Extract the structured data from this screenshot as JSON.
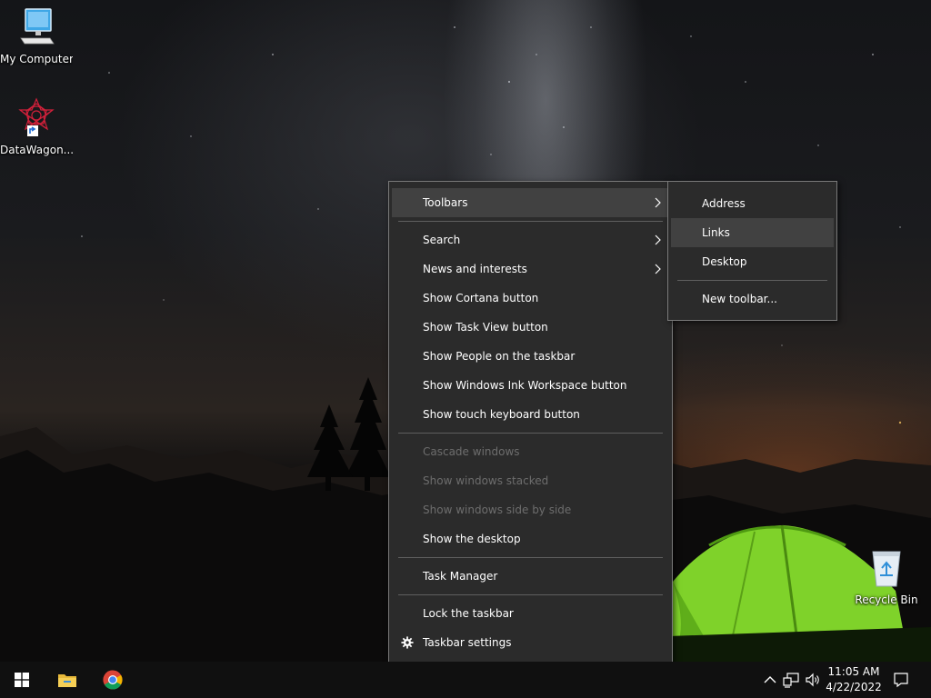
{
  "desktop": {
    "icons": [
      {
        "label": "My Computer",
        "icon": "computer-icon"
      },
      {
        "label": "DataWagon...",
        "icon": "datawagon-icon"
      },
      {
        "label": "Recycle Bin",
        "icon": "recycle-bin-icon"
      }
    ]
  },
  "context_menu": {
    "items": [
      {
        "label": "Toolbars",
        "submenu": true
      },
      {
        "label": "Search",
        "submenu": true
      },
      {
        "label": "News and interests",
        "submenu": true
      },
      {
        "label": "Show Cortana button"
      },
      {
        "label": "Show Task View button"
      },
      {
        "label": "Show People on the taskbar"
      },
      {
        "label": "Show Windows Ink Workspace button"
      },
      {
        "label": "Show touch keyboard button"
      },
      {
        "label": "Cascade windows",
        "disabled": true
      },
      {
        "label": "Show windows stacked",
        "disabled": true
      },
      {
        "label": "Show windows side by side",
        "disabled": true
      },
      {
        "label": "Show the desktop"
      },
      {
        "label": "Task Manager"
      },
      {
        "label": "Lock the taskbar"
      },
      {
        "label": "Taskbar settings",
        "icon": "gear-icon"
      }
    ]
  },
  "toolbars_submenu": {
    "items": [
      {
        "label": "Address"
      },
      {
        "label": "Links"
      },
      {
        "label": "Desktop"
      },
      {
        "label": "New toolbar..."
      }
    ]
  },
  "taskbar": {
    "pinned": [
      "windows-start-icon",
      "file-explorer-icon",
      "chrome-icon"
    ],
    "tray": [
      "chevron-up-icon",
      "network-icon",
      "volume-icon"
    ],
    "clock": {
      "time": "11:05 AM",
      "date": "4/22/2022"
    },
    "notification_icon": "action-center-icon"
  },
  "colors": {
    "menu_bg": "#2b2b2b",
    "menu_hover": "#414141",
    "menu_disabled_text": "#6d6d6d",
    "taskbar_bg": "#101010",
    "tent": "#7fd22a"
  }
}
